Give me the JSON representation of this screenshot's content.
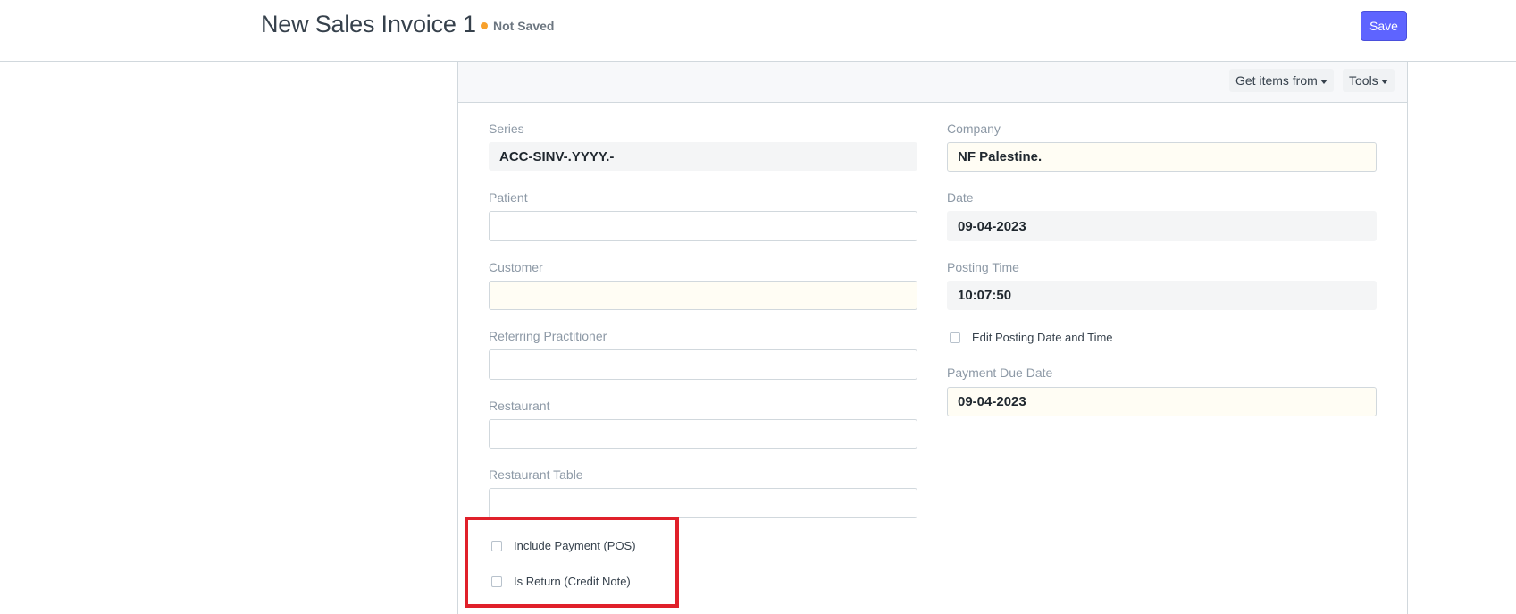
{
  "header": {
    "title": "New Sales Invoice 1",
    "status": "Not Saved",
    "save_label": "Save"
  },
  "toolbar": {
    "get_items_label": "Get items from",
    "tools_label": "Tools"
  },
  "left_column": {
    "series": {
      "label": "Series",
      "value": "ACC-SINV-.YYYY.-"
    },
    "patient": {
      "label": "Patient",
      "value": ""
    },
    "customer": {
      "label": "Customer",
      "value": ""
    },
    "referring_practitioner": {
      "label": "Referring Practitioner",
      "value": ""
    },
    "restaurant": {
      "label": "Restaurant",
      "value": ""
    },
    "restaurant_table": {
      "label": "Restaurant Table",
      "value": ""
    },
    "include_payment": {
      "label": "Include Payment (POS)",
      "checked": false
    },
    "is_return": {
      "label": "Is Return (Credit Note)",
      "checked": false
    }
  },
  "right_column": {
    "company": {
      "label": "Company",
      "value": "NF Palestine."
    },
    "date": {
      "label": "Date",
      "value": "09-04-2023"
    },
    "posting_time": {
      "label": "Posting Time",
      "value": "10:07:50"
    },
    "edit_posting": {
      "label": "Edit Posting Date and Time",
      "checked": false
    },
    "payment_due_date": {
      "label": "Payment Due Date",
      "value": "09-04-2023"
    }
  },
  "colors": {
    "primary": "#5e64ff",
    "status_dot": "#f8a12c",
    "highlight": "#e0202a",
    "mandatory_bg": "#fffdf4",
    "readonly_bg": "#f4f5f6"
  }
}
